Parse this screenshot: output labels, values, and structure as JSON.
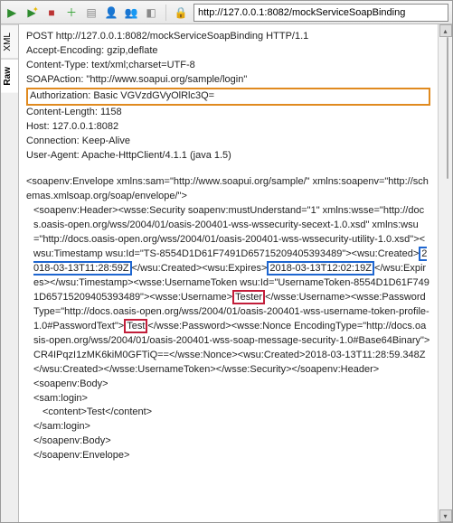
{
  "toolbar": {
    "url": "http://127.0.0.1:8082/mockServiceSoapBinding"
  },
  "tabs": {
    "raw": "Raw",
    "xml": "XML"
  },
  "headers": {
    "request_line": "POST http://127.0.0.1:8082/mockServiceSoapBinding HTTP/1.1",
    "accept_encoding": "Accept-Encoding: gzip,deflate",
    "content_type": "Content-Type: text/xml;charset=UTF-8",
    "soap_action": "SOAPAction: \"http://www.soapui.org/sample/login\"",
    "authorization": "Authorization: Basic VGVzdGVyOlRlc3Q=",
    "content_length": "Content-Length: 1158",
    "host": "Host: 127.0.0.1:8082",
    "connection": "Connection: Keep-Alive",
    "user_agent": "User-Agent: Apache-HttpClient/4.1.1 (java 1.5)"
  },
  "soap": {
    "env_open": "<soapenv:Envelope xmlns:sam=\"http://www.soapui.org/sample/\" xmlns:soapenv=\"http://schemas.xmlsoap.org/soap/envelope/\">",
    "sec_open": "<soapenv:Header><wsse:Security soapenv:mustUnderstand=\"1\" xmlns:wsse=\"http://docs.oasis-open.org/wss/2004/01/oasis-200401-wss-wssecurity-secext-1.0.xsd\" xmlns:wsu=\"http://docs.oasis-open.org/wss/2004/01/oasis-200401-wss-wssecurity-utility-1.0.xsd\"><wsu:Timestamp wsu:Id=\"TS-8554D1D61F7491D65715209405393489\"><wsu:Created>",
    "ts_created": "2018-03-13T11:28:59Z",
    "sec_mid1": "</wsu:Created><wsu:Expires>",
    "ts_expires": "2018-03-13T12:02:19Z",
    "sec_mid2": "</wsu:Expires></wsu:Timestamp><wsse:UsernameToken wsu:Id=\"UsernameToken-8554D1D61F7491D65715209405393489\"><wsse:Username>",
    "username": "Tester",
    "sec_mid3": "</wsse:Username><wsse:Password Type=\"http://docs.oasis-open.org/wss/2004/01/oasis-200401-wss-username-token-profile-1.0#PasswordText\">",
    "password": "Test",
    "sec_mid4": "</wsse:Password><wsse:Nonce EncodingType=\"http://docs.oasis-open.org/wss/2004/01/oasis-200401-wss-soap-message-security-1.0#Base64Binary\">CR4IPqzI1zMK6kiM0GFTiQ==</wsse:Nonce><wsu:Created>2018-03-13T11:28:59.348Z</wsu:Created></wsse:UsernameToken></wsse:Security></soapenv:Header>",
    "body_open": "<soapenv:Body>",
    "login_open": "<sam:login>",
    "content": "<content>Test</content>",
    "login_close": "</sam:login>",
    "body_close": "</soapenv:Body>",
    "env_close": "</soapenv:Envelope>"
  }
}
